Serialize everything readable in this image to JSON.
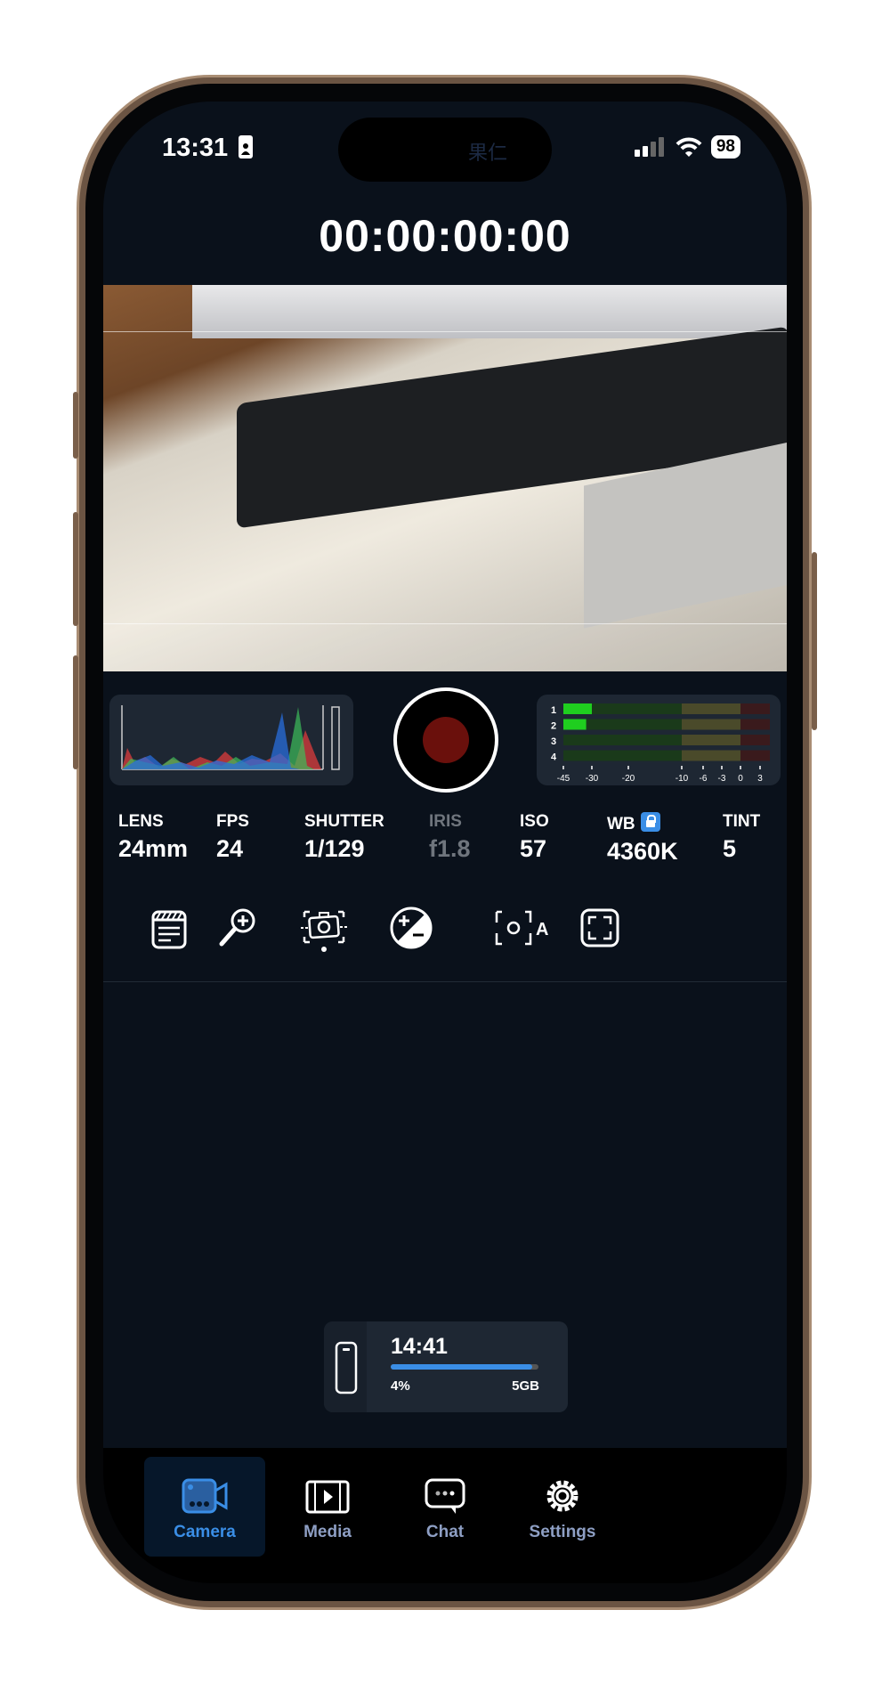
{
  "status_bar": {
    "time": "13:31",
    "battery": "98",
    "island_text": "果仁"
  },
  "timecode": "00:00:00:00",
  "histogram": {
    "channels": [
      "red",
      "green",
      "blue"
    ]
  },
  "record_button": {
    "state": "idle",
    "color": "#6a100c"
  },
  "audio_meter": {
    "channels": [
      "1",
      "2",
      "3",
      "4"
    ],
    "levels_db": [
      -30,
      -33,
      -45,
      -45
    ],
    "scale": [
      "-45",
      "-30",
      "-20",
      "-10",
      "-6",
      "-3",
      "0",
      "3"
    ]
  },
  "params": [
    {
      "label": "LENS",
      "value": "24mm"
    },
    {
      "label": "FPS",
      "value": "24"
    },
    {
      "label": "SHUTTER",
      "value": "1/129"
    },
    {
      "label": "IRIS",
      "value": "f1.8",
      "disabled": true
    },
    {
      "label": "ISO",
      "value": "57"
    },
    {
      "label": "WB",
      "value": "4360K",
      "locked": true
    },
    {
      "label": "TINT",
      "value": "5"
    }
  ],
  "tools": [
    "slate-icon",
    "zoom-in-icon",
    "stabilization-icon",
    "exposure-compensation-icon",
    "auto-focus-icon",
    "frame-guides-icon"
  ],
  "tools_af_label": "A",
  "storage": {
    "remaining_time": "14:41",
    "percent": "4%",
    "capacity": "5GB",
    "used_fraction": 0.96
  },
  "nav": [
    {
      "label": "Camera",
      "active": true
    },
    {
      "label": "Media"
    },
    {
      "label": "Chat"
    },
    {
      "label": "Settings"
    }
  ],
  "colors": {
    "accent": "#3a8ee6",
    "background": "#0a111b",
    "panel": "#1e2733"
  }
}
